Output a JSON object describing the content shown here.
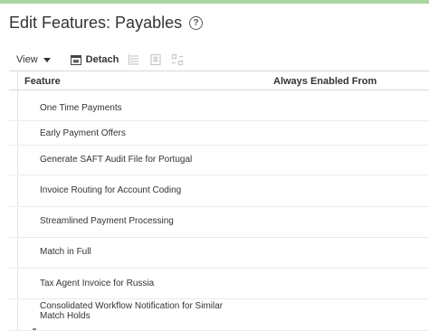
{
  "page": {
    "title": "Edit Features: Payables"
  },
  "toolbar": {
    "view_label": "View",
    "detach_label": "Detach"
  },
  "table": {
    "columns": [
      "Feature",
      "Always Enabled From"
    ],
    "rows": [
      {
        "feature": "One Time Payments",
        "always_enabled_from": ""
      },
      {
        "feature": "Early Payment Offers",
        "always_enabled_from": ""
      },
      {
        "feature": "Generate SAFT Audit File for Portugal",
        "always_enabled_from": ""
      },
      {
        "feature": "Invoice Routing for Account Coding",
        "always_enabled_from": ""
      },
      {
        "feature": "Streamlined Payment Processing",
        "always_enabled_from": ""
      },
      {
        "feature": "Match in Full",
        "always_enabled_from": ""
      },
      {
        "feature": "Tax Agent Invoice for Russia",
        "always_enabled_from": ""
      },
      {
        "feature": "Consolidated Workflow Notification for Similar Match Holds",
        "always_enabled_from": ""
      }
    ]
  },
  "colors": {
    "accent_bar": "#a8d5a0",
    "text": "#333333",
    "divider": "#d9d9d9"
  }
}
